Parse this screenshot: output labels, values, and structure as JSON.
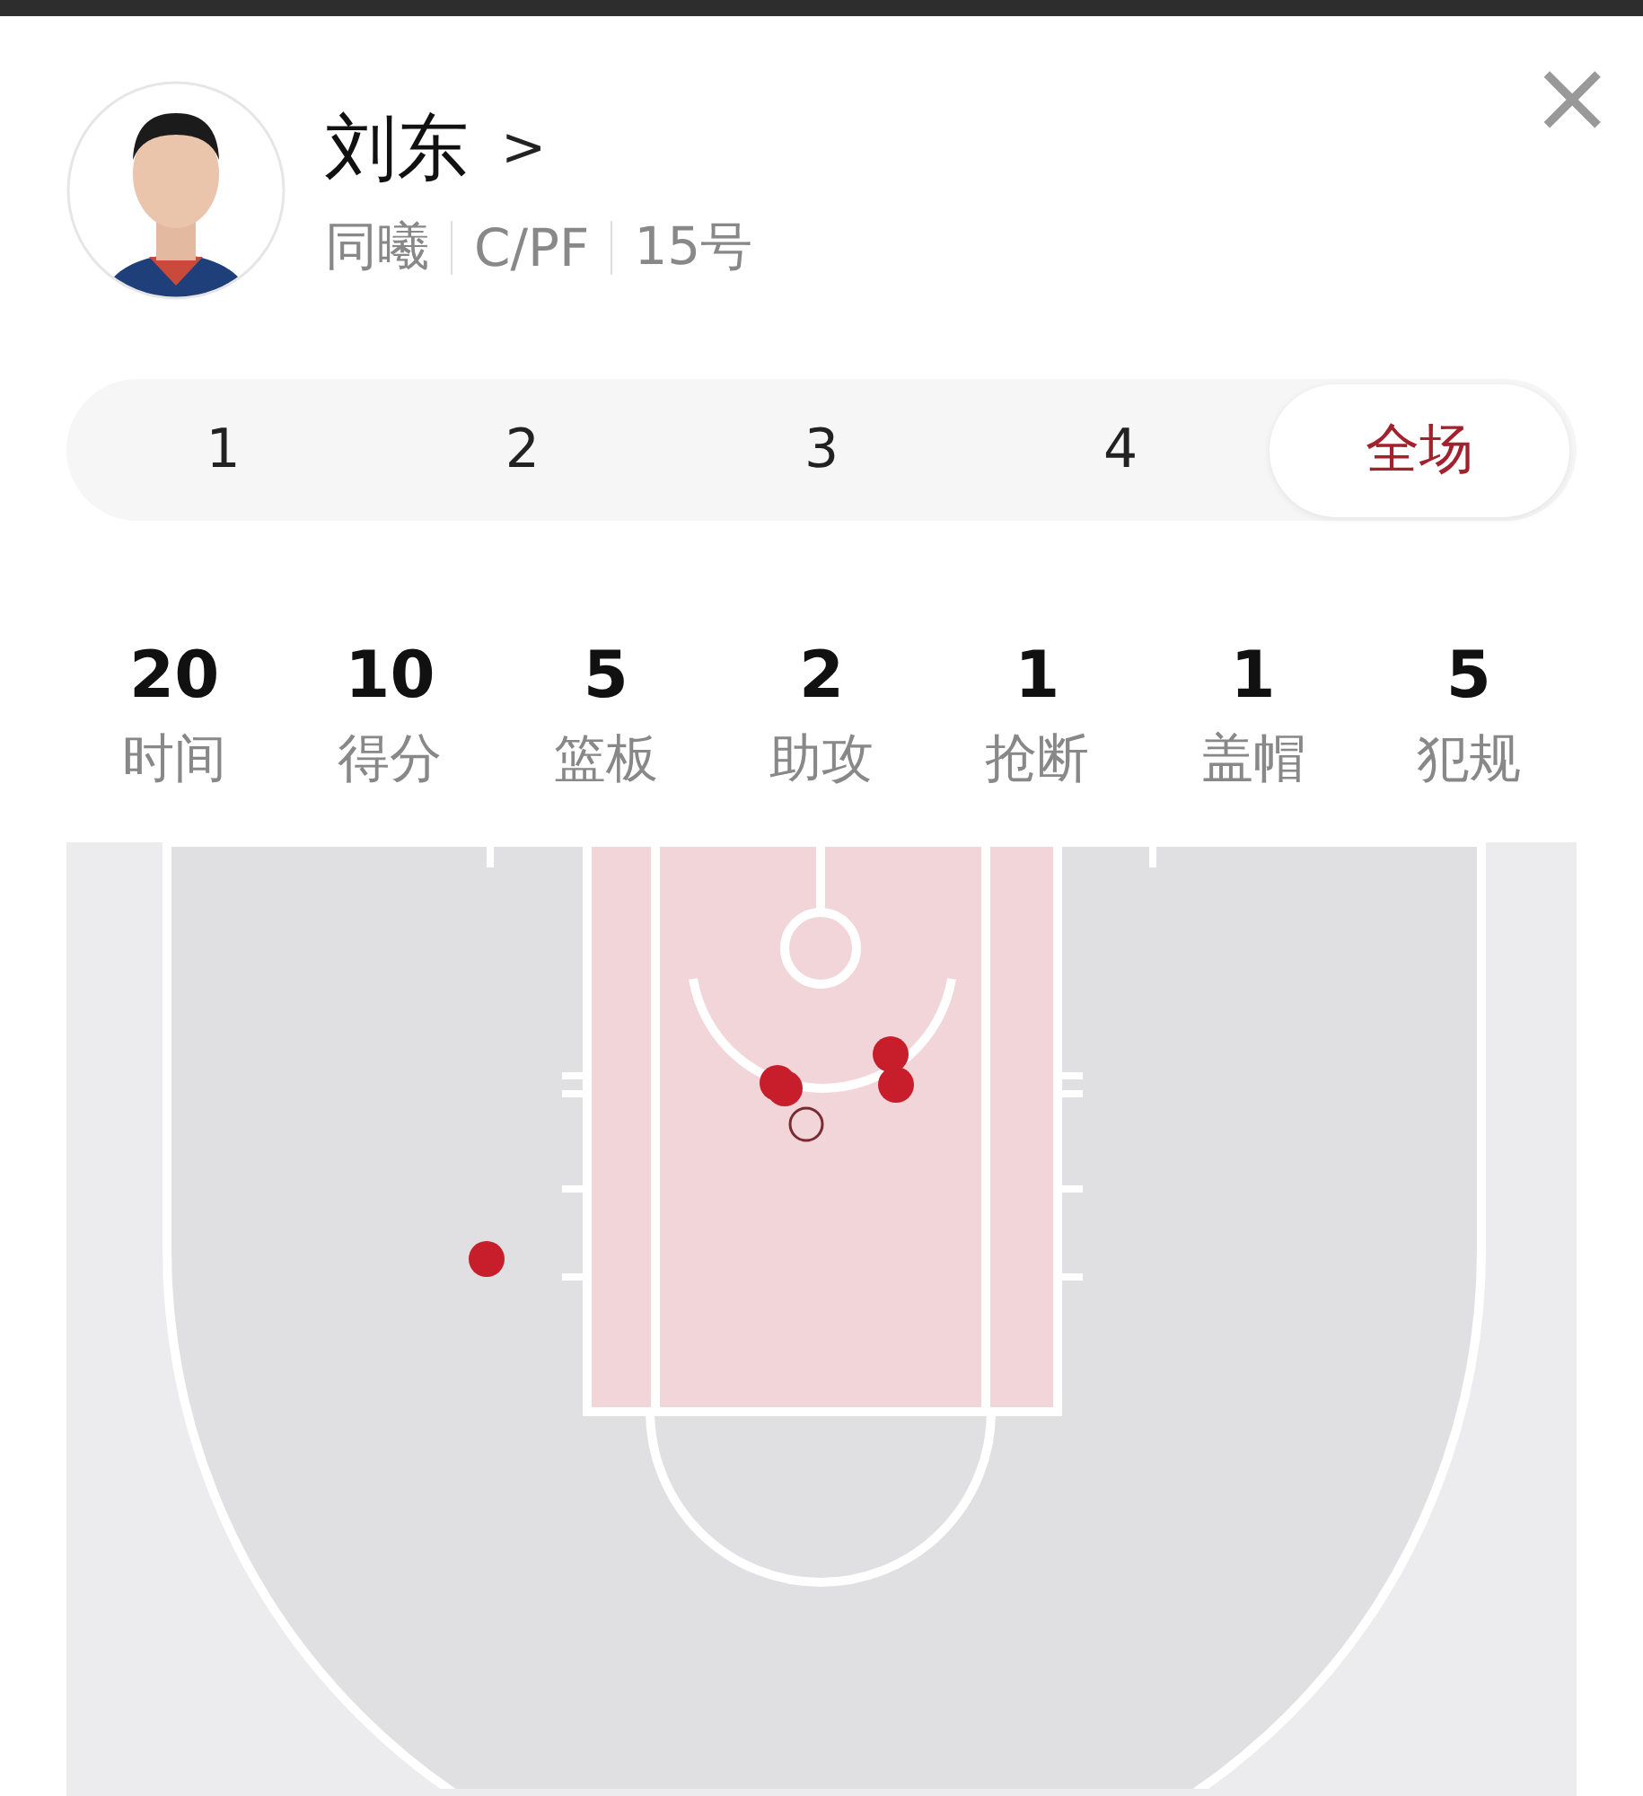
{
  "player": {
    "name": "刘东",
    "arrow": ">",
    "team": "同曦",
    "position": "C/PF",
    "number": "15号"
  },
  "close": "×",
  "periods": [
    {
      "label": "1",
      "selected": false
    },
    {
      "label": "2",
      "selected": false
    },
    {
      "label": "3",
      "selected": false
    },
    {
      "label": "4",
      "selected": false
    },
    {
      "label": "全场",
      "selected": true
    }
  ],
  "stats": [
    {
      "value": "20",
      "label": "时间"
    },
    {
      "value": "10",
      "label": "得分"
    },
    {
      "value": "5",
      "label": "篮板"
    },
    {
      "value": "2",
      "label": "助攻"
    },
    {
      "value": "1",
      "label": "抢断"
    },
    {
      "value": "1",
      "label": "盖帽"
    },
    {
      "value": "5",
      "label": "犯规"
    }
  ],
  "shots": [
    {
      "made": true
    },
    {
      "made": true
    },
    {
      "made": true
    },
    {
      "made": true
    },
    {
      "made": true
    },
    {
      "made": false
    }
  ]
}
